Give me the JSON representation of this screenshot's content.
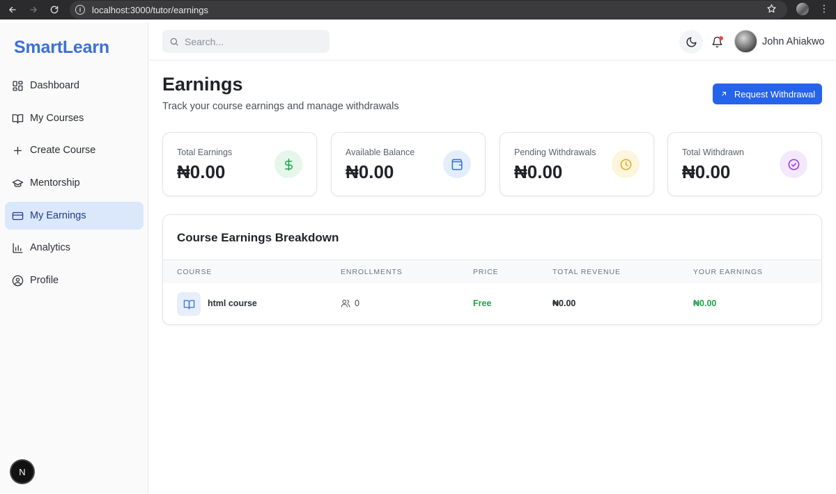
{
  "browser": {
    "url": "localhost:3000/tutor/earnings"
  },
  "sidebar": {
    "brand": "SmartLearn",
    "items": [
      {
        "label": "Dashboard",
        "icon": "dashboard-icon"
      },
      {
        "label": "My Courses",
        "icon": "book-icon"
      },
      {
        "label": "Create Course",
        "icon": "plus-icon"
      },
      {
        "label": "Mentorship",
        "icon": "graduation-cap-icon"
      },
      {
        "label": "My Earnings",
        "icon": "credit-card-icon",
        "active": true
      },
      {
        "label": "Analytics",
        "icon": "bar-chart-icon"
      },
      {
        "label": "Profile",
        "icon": "user-circle-icon"
      }
    ],
    "badge": "N"
  },
  "topbar": {
    "search_placeholder": "Search...",
    "user_name": "John Ahiakwo"
  },
  "page": {
    "title": "Earnings",
    "subtitle": "Track your course earnings and manage withdrawals",
    "withdraw_label": "Request Withdrawal"
  },
  "stats": [
    {
      "label": "Total Earnings",
      "value": "₦0.00",
      "icon": "dollar-icon",
      "color": "#22a04b",
      "bg": "#e6f6ea"
    },
    {
      "label": "Available Balance",
      "value": "₦0.00",
      "icon": "wallet-icon",
      "color": "#2f6fe0",
      "bg": "#e4edfc"
    },
    {
      "label": "Pending Withdrawals",
      "value": "₦0.00",
      "icon": "clock-icon",
      "color": "#e0a91c",
      "bg": "#fdf5dc"
    },
    {
      "label": "Total Withdrawn",
      "value": "₦0.00",
      "icon": "check-circle-icon",
      "color": "#9333ea",
      "bg": "#f3e8fd"
    }
  ],
  "breakdown": {
    "title": "Course Earnings Breakdown",
    "headers": [
      "COURSE",
      "ENROLLMENTS",
      "PRICE",
      "TOTAL REVENUE",
      "YOUR EARNINGS"
    ],
    "rows": [
      {
        "course": "html course",
        "enrollments": "0",
        "price": "Free",
        "total_revenue": "₦0.00",
        "your_earnings": "₦0.00"
      }
    ]
  }
}
